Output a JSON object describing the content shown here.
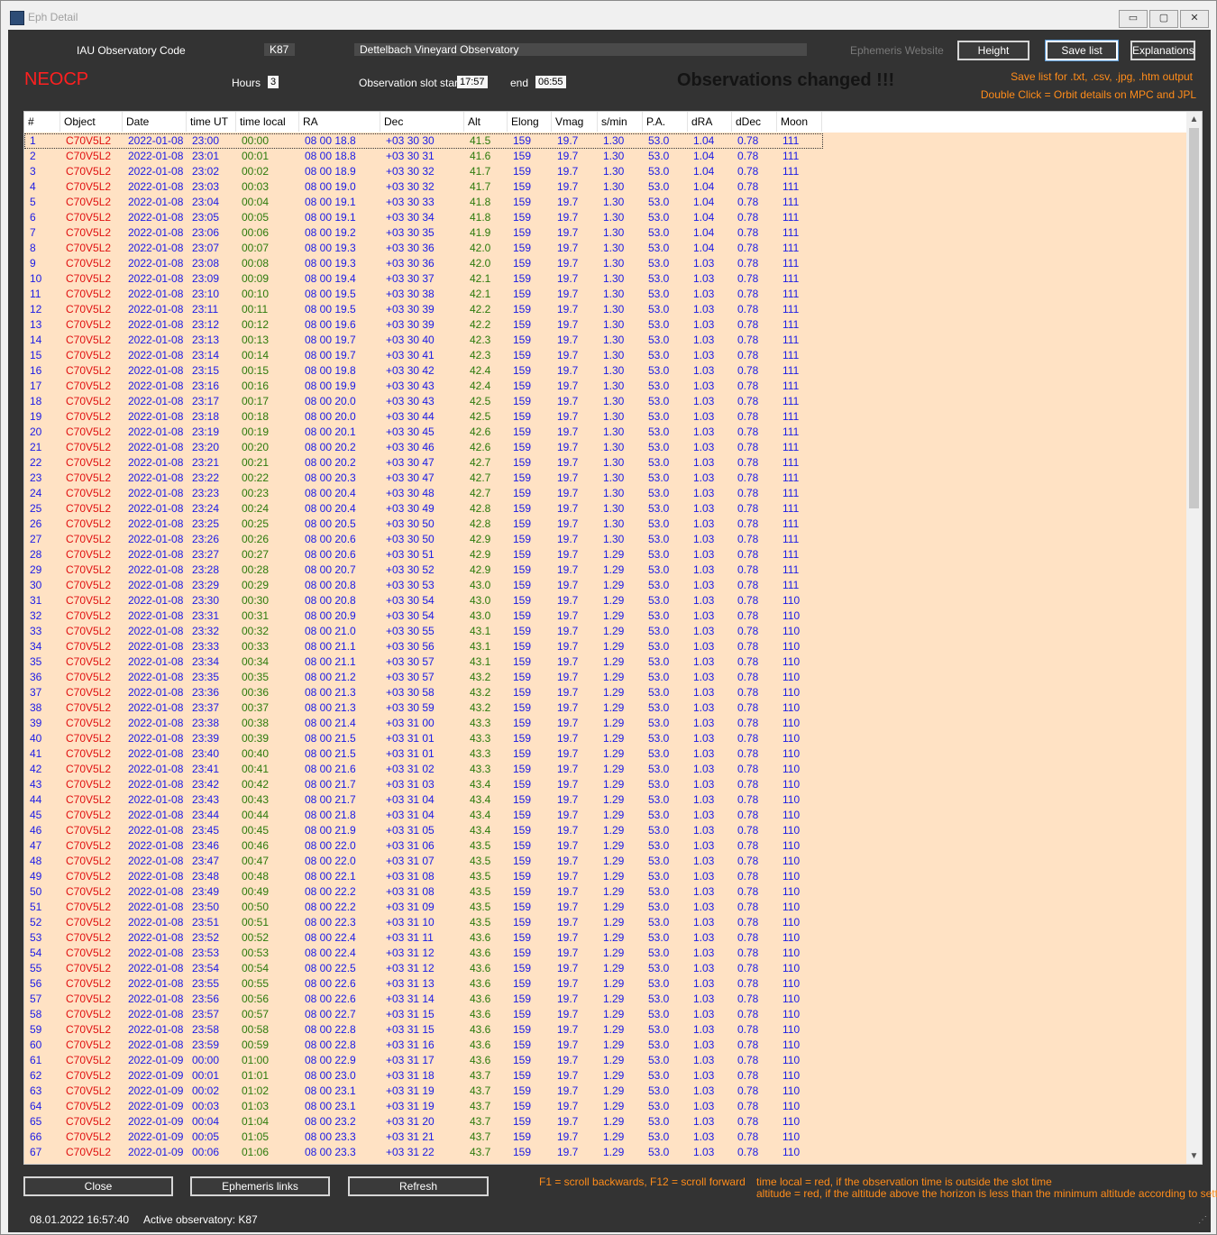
{
  "window": {
    "title": "Eph Detail",
    "min": "▭",
    "max": "▢",
    "close": "✕"
  },
  "header": {
    "iau_label": "IAU Observatory Code",
    "iau_code": "K87",
    "observatory_name": "Dettelbach Vineyard Observatory",
    "ephemeris_website": "Ephemeris Website",
    "height_button": "Height",
    "save_list_button": "Save list",
    "explanations_button": "Explanations",
    "neocp": "NEOCP",
    "hours_label": "Hours",
    "hours_value": "3",
    "slot_start_label": "Observation slot start",
    "slot_start_value": "17:57",
    "end_label": "end",
    "end_value": "06:55",
    "changed_notice": "Observations changed !!!",
    "save_hint": "Save list for .txt, .csv, .jpg, .htm output",
    "dblclick_hint": "Double Click = Orbit details on MPC and JPL"
  },
  "columns": [
    "#",
    "Object",
    "Date",
    "time UT",
    "time local",
    "RA",
    "Dec",
    "Alt",
    "Elong",
    "Vmag",
    "s/min",
    "P.A.",
    "dRA",
    "dDec",
    "Moon"
  ],
  "rows": [
    [
      "1",
      "C70V5L2",
      "2022-01-08",
      "23:00",
      "00:00",
      "08 00 18.8",
      "+03 30 30",
      "41.5",
      "159",
      "19.7",
      "1.30",
      "53.0",
      "1.04",
      "0.78",
      "111"
    ],
    [
      "2",
      "C70V5L2",
      "2022-01-08",
      "23:01",
      "00:01",
      "08 00 18.8",
      "+03 30 31",
      "41.6",
      "159",
      "19.7",
      "1.30",
      "53.0",
      "1.04",
      "0.78",
      "111"
    ],
    [
      "3",
      "C70V5L2",
      "2022-01-08",
      "23:02",
      "00:02",
      "08 00 18.9",
      "+03 30 32",
      "41.7",
      "159",
      "19.7",
      "1.30",
      "53.0",
      "1.04",
      "0.78",
      "111"
    ],
    [
      "4",
      "C70V5L2",
      "2022-01-08",
      "23:03",
      "00:03",
      "08 00 19.0",
      "+03 30 32",
      "41.7",
      "159",
      "19.7",
      "1.30",
      "53.0",
      "1.04",
      "0.78",
      "111"
    ],
    [
      "5",
      "C70V5L2",
      "2022-01-08",
      "23:04",
      "00:04",
      "08 00 19.1",
      "+03 30 33",
      "41.8",
      "159",
      "19.7",
      "1.30",
      "53.0",
      "1.04",
      "0.78",
      "111"
    ],
    [
      "6",
      "C70V5L2",
      "2022-01-08",
      "23:05",
      "00:05",
      "08 00 19.1",
      "+03 30 34",
      "41.8",
      "159",
      "19.7",
      "1.30",
      "53.0",
      "1.04",
      "0.78",
      "111"
    ],
    [
      "7",
      "C70V5L2",
      "2022-01-08",
      "23:06",
      "00:06",
      "08 00 19.2",
      "+03 30 35",
      "41.9",
      "159",
      "19.7",
      "1.30",
      "53.0",
      "1.04",
      "0.78",
      "111"
    ],
    [
      "8",
      "C70V5L2",
      "2022-01-08",
      "23:07",
      "00:07",
      "08 00 19.3",
      "+03 30 36",
      "42.0",
      "159",
      "19.7",
      "1.30",
      "53.0",
      "1.04",
      "0.78",
      "111"
    ],
    [
      "9",
      "C70V5L2",
      "2022-01-08",
      "23:08",
      "00:08",
      "08 00 19.3",
      "+03 30 36",
      "42.0",
      "159",
      "19.7",
      "1.30",
      "53.0",
      "1.03",
      "0.78",
      "111"
    ],
    [
      "10",
      "C70V5L2",
      "2022-01-08",
      "23:09",
      "00:09",
      "08 00 19.4",
      "+03 30 37",
      "42.1",
      "159",
      "19.7",
      "1.30",
      "53.0",
      "1.03",
      "0.78",
      "111"
    ],
    [
      "11",
      "C70V5L2",
      "2022-01-08",
      "23:10",
      "00:10",
      "08 00 19.5",
      "+03 30 38",
      "42.1",
      "159",
      "19.7",
      "1.30",
      "53.0",
      "1.03",
      "0.78",
      "111"
    ],
    [
      "12",
      "C70V5L2",
      "2022-01-08",
      "23:11",
      "00:11",
      "08 00 19.5",
      "+03 30 39",
      "42.2",
      "159",
      "19.7",
      "1.30",
      "53.0",
      "1.03",
      "0.78",
      "111"
    ],
    [
      "13",
      "C70V5L2",
      "2022-01-08",
      "23:12",
      "00:12",
      "08 00 19.6",
      "+03 30 39",
      "42.2",
      "159",
      "19.7",
      "1.30",
      "53.0",
      "1.03",
      "0.78",
      "111"
    ],
    [
      "14",
      "C70V5L2",
      "2022-01-08",
      "23:13",
      "00:13",
      "08 00 19.7",
      "+03 30 40",
      "42.3",
      "159",
      "19.7",
      "1.30",
      "53.0",
      "1.03",
      "0.78",
      "111"
    ],
    [
      "15",
      "C70V5L2",
      "2022-01-08",
      "23:14",
      "00:14",
      "08 00 19.7",
      "+03 30 41",
      "42.3",
      "159",
      "19.7",
      "1.30",
      "53.0",
      "1.03",
      "0.78",
      "111"
    ],
    [
      "16",
      "C70V5L2",
      "2022-01-08",
      "23:15",
      "00:15",
      "08 00 19.8",
      "+03 30 42",
      "42.4",
      "159",
      "19.7",
      "1.30",
      "53.0",
      "1.03",
      "0.78",
      "111"
    ],
    [
      "17",
      "C70V5L2",
      "2022-01-08",
      "23:16",
      "00:16",
      "08 00 19.9",
      "+03 30 43",
      "42.4",
      "159",
      "19.7",
      "1.30",
      "53.0",
      "1.03",
      "0.78",
      "111"
    ],
    [
      "18",
      "C70V5L2",
      "2022-01-08",
      "23:17",
      "00:17",
      "08 00 20.0",
      "+03 30 43",
      "42.5",
      "159",
      "19.7",
      "1.30",
      "53.0",
      "1.03",
      "0.78",
      "111"
    ],
    [
      "19",
      "C70V5L2",
      "2022-01-08",
      "23:18",
      "00:18",
      "08 00 20.0",
      "+03 30 44",
      "42.5",
      "159",
      "19.7",
      "1.30",
      "53.0",
      "1.03",
      "0.78",
      "111"
    ],
    [
      "20",
      "C70V5L2",
      "2022-01-08",
      "23:19",
      "00:19",
      "08 00 20.1",
      "+03 30 45",
      "42.6",
      "159",
      "19.7",
      "1.30",
      "53.0",
      "1.03",
      "0.78",
      "111"
    ],
    [
      "21",
      "C70V5L2",
      "2022-01-08",
      "23:20",
      "00:20",
      "08 00 20.2",
      "+03 30 46",
      "42.6",
      "159",
      "19.7",
      "1.30",
      "53.0",
      "1.03",
      "0.78",
      "111"
    ],
    [
      "22",
      "C70V5L2",
      "2022-01-08",
      "23:21",
      "00:21",
      "08 00 20.2",
      "+03 30 47",
      "42.7",
      "159",
      "19.7",
      "1.30",
      "53.0",
      "1.03",
      "0.78",
      "111"
    ],
    [
      "23",
      "C70V5L2",
      "2022-01-08",
      "23:22",
      "00:22",
      "08 00 20.3",
      "+03 30 47",
      "42.7",
      "159",
      "19.7",
      "1.30",
      "53.0",
      "1.03",
      "0.78",
      "111"
    ],
    [
      "24",
      "C70V5L2",
      "2022-01-08",
      "23:23",
      "00:23",
      "08 00 20.4",
      "+03 30 48",
      "42.7",
      "159",
      "19.7",
      "1.30",
      "53.0",
      "1.03",
      "0.78",
      "111"
    ],
    [
      "25",
      "C70V5L2",
      "2022-01-08",
      "23:24",
      "00:24",
      "08 00 20.4",
      "+03 30 49",
      "42.8",
      "159",
      "19.7",
      "1.30",
      "53.0",
      "1.03",
      "0.78",
      "111"
    ],
    [
      "26",
      "C70V5L2",
      "2022-01-08",
      "23:25",
      "00:25",
      "08 00 20.5",
      "+03 30 50",
      "42.8",
      "159",
      "19.7",
      "1.30",
      "53.0",
      "1.03",
      "0.78",
      "111"
    ],
    [
      "27",
      "C70V5L2",
      "2022-01-08",
      "23:26",
      "00:26",
      "08 00 20.6",
      "+03 30 50",
      "42.9",
      "159",
      "19.7",
      "1.30",
      "53.0",
      "1.03",
      "0.78",
      "111"
    ],
    [
      "28",
      "C70V5L2",
      "2022-01-08",
      "23:27",
      "00:27",
      "08 00 20.6",
      "+03 30 51",
      "42.9",
      "159",
      "19.7",
      "1.29",
      "53.0",
      "1.03",
      "0.78",
      "111"
    ],
    [
      "29",
      "C70V5L2",
      "2022-01-08",
      "23:28",
      "00:28",
      "08 00 20.7",
      "+03 30 52",
      "42.9",
      "159",
      "19.7",
      "1.29",
      "53.0",
      "1.03",
      "0.78",
      "111"
    ],
    [
      "30",
      "C70V5L2",
      "2022-01-08",
      "23:29",
      "00:29",
      "08 00 20.8",
      "+03 30 53",
      "43.0",
      "159",
      "19.7",
      "1.29",
      "53.0",
      "1.03",
      "0.78",
      "111"
    ],
    [
      "31",
      "C70V5L2",
      "2022-01-08",
      "23:30",
      "00:30",
      "08 00 20.8",
      "+03 30 54",
      "43.0",
      "159",
      "19.7",
      "1.29",
      "53.0",
      "1.03",
      "0.78",
      "110"
    ],
    [
      "32",
      "C70V5L2",
      "2022-01-08",
      "23:31",
      "00:31",
      "08 00 20.9",
      "+03 30 54",
      "43.0",
      "159",
      "19.7",
      "1.29",
      "53.0",
      "1.03",
      "0.78",
      "110"
    ],
    [
      "33",
      "C70V5L2",
      "2022-01-08",
      "23:32",
      "00:32",
      "08 00 21.0",
      "+03 30 55",
      "43.1",
      "159",
      "19.7",
      "1.29",
      "53.0",
      "1.03",
      "0.78",
      "110"
    ],
    [
      "34",
      "C70V5L2",
      "2022-01-08",
      "23:33",
      "00:33",
      "08 00 21.1",
      "+03 30 56",
      "43.1",
      "159",
      "19.7",
      "1.29",
      "53.0",
      "1.03",
      "0.78",
      "110"
    ],
    [
      "35",
      "C70V5L2",
      "2022-01-08",
      "23:34",
      "00:34",
      "08 00 21.1",
      "+03 30 57",
      "43.1",
      "159",
      "19.7",
      "1.29",
      "53.0",
      "1.03",
      "0.78",
      "110"
    ],
    [
      "36",
      "C70V5L2",
      "2022-01-08",
      "23:35",
      "00:35",
      "08 00 21.2",
      "+03 30 57",
      "43.2",
      "159",
      "19.7",
      "1.29",
      "53.0",
      "1.03",
      "0.78",
      "110"
    ],
    [
      "37",
      "C70V5L2",
      "2022-01-08",
      "23:36",
      "00:36",
      "08 00 21.3",
      "+03 30 58",
      "43.2",
      "159",
      "19.7",
      "1.29",
      "53.0",
      "1.03",
      "0.78",
      "110"
    ],
    [
      "38",
      "C70V5L2",
      "2022-01-08",
      "23:37",
      "00:37",
      "08 00 21.3",
      "+03 30 59",
      "43.2",
      "159",
      "19.7",
      "1.29",
      "53.0",
      "1.03",
      "0.78",
      "110"
    ],
    [
      "39",
      "C70V5L2",
      "2022-01-08",
      "23:38",
      "00:38",
      "08 00 21.4",
      "+03 31 00",
      "43.3",
      "159",
      "19.7",
      "1.29",
      "53.0",
      "1.03",
      "0.78",
      "110"
    ],
    [
      "40",
      "C70V5L2",
      "2022-01-08",
      "23:39",
      "00:39",
      "08 00 21.5",
      "+03 31 01",
      "43.3",
      "159",
      "19.7",
      "1.29",
      "53.0",
      "1.03",
      "0.78",
      "110"
    ],
    [
      "41",
      "C70V5L2",
      "2022-01-08",
      "23:40",
      "00:40",
      "08 00 21.5",
      "+03 31 01",
      "43.3",
      "159",
      "19.7",
      "1.29",
      "53.0",
      "1.03",
      "0.78",
      "110"
    ],
    [
      "42",
      "C70V5L2",
      "2022-01-08",
      "23:41",
      "00:41",
      "08 00 21.6",
      "+03 31 02",
      "43.3",
      "159",
      "19.7",
      "1.29",
      "53.0",
      "1.03",
      "0.78",
      "110"
    ],
    [
      "43",
      "C70V5L2",
      "2022-01-08",
      "23:42",
      "00:42",
      "08 00 21.7",
      "+03 31 03",
      "43.4",
      "159",
      "19.7",
      "1.29",
      "53.0",
      "1.03",
      "0.78",
      "110"
    ],
    [
      "44",
      "C70V5L2",
      "2022-01-08",
      "23:43",
      "00:43",
      "08 00 21.7",
      "+03 31 04",
      "43.4",
      "159",
      "19.7",
      "1.29",
      "53.0",
      "1.03",
      "0.78",
      "110"
    ],
    [
      "45",
      "C70V5L2",
      "2022-01-08",
      "23:44",
      "00:44",
      "08 00 21.8",
      "+03 31 04",
      "43.4",
      "159",
      "19.7",
      "1.29",
      "53.0",
      "1.03",
      "0.78",
      "110"
    ],
    [
      "46",
      "C70V5L2",
      "2022-01-08",
      "23:45",
      "00:45",
      "08 00 21.9",
      "+03 31 05",
      "43.4",
      "159",
      "19.7",
      "1.29",
      "53.0",
      "1.03",
      "0.78",
      "110"
    ],
    [
      "47",
      "C70V5L2",
      "2022-01-08",
      "23:46",
      "00:46",
      "08 00 22.0",
      "+03 31 06",
      "43.5",
      "159",
      "19.7",
      "1.29",
      "53.0",
      "1.03",
      "0.78",
      "110"
    ],
    [
      "48",
      "C70V5L2",
      "2022-01-08",
      "23:47",
      "00:47",
      "08 00 22.0",
      "+03 31 07",
      "43.5",
      "159",
      "19.7",
      "1.29",
      "53.0",
      "1.03",
      "0.78",
      "110"
    ],
    [
      "49",
      "C70V5L2",
      "2022-01-08",
      "23:48",
      "00:48",
      "08 00 22.1",
      "+03 31 08",
      "43.5",
      "159",
      "19.7",
      "1.29",
      "53.0",
      "1.03",
      "0.78",
      "110"
    ],
    [
      "50",
      "C70V5L2",
      "2022-01-08",
      "23:49",
      "00:49",
      "08 00 22.2",
      "+03 31 08",
      "43.5",
      "159",
      "19.7",
      "1.29",
      "53.0",
      "1.03",
      "0.78",
      "110"
    ],
    [
      "51",
      "C70V5L2",
      "2022-01-08",
      "23:50",
      "00:50",
      "08 00 22.2",
      "+03 31 09",
      "43.5",
      "159",
      "19.7",
      "1.29",
      "53.0",
      "1.03",
      "0.78",
      "110"
    ],
    [
      "52",
      "C70V5L2",
      "2022-01-08",
      "23:51",
      "00:51",
      "08 00 22.3",
      "+03 31 10",
      "43.5",
      "159",
      "19.7",
      "1.29",
      "53.0",
      "1.03",
      "0.78",
      "110"
    ],
    [
      "53",
      "C70V5L2",
      "2022-01-08",
      "23:52",
      "00:52",
      "08 00 22.4",
      "+03 31 11",
      "43.6",
      "159",
      "19.7",
      "1.29",
      "53.0",
      "1.03",
      "0.78",
      "110"
    ],
    [
      "54",
      "C70V5L2",
      "2022-01-08",
      "23:53",
      "00:53",
      "08 00 22.4",
      "+03 31 12",
      "43.6",
      "159",
      "19.7",
      "1.29",
      "53.0",
      "1.03",
      "0.78",
      "110"
    ],
    [
      "55",
      "C70V5L2",
      "2022-01-08",
      "23:54",
      "00:54",
      "08 00 22.5",
      "+03 31 12",
      "43.6",
      "159",
      "19.7",
      "1.29",
      "53.0",
      "1.03",
      "0.78",
      "110"
    ],
    [
      "56",
      "C70V5L2",
      "2022-01-08",
      "23:55",
      "00:55",
      "08 00 22.6",
      "+03 31 13",
      "43.6",
      "159",
      "19.7",
      "1.29",
      "53.0",
      "1.03",
      "0.78",
      "110"
    ],
    [
      "57",
      "C70V5L2",
      "2022-01-08",
      "23:56",
      "00:56",
      "08 00 22.6",
      "+03 31 14",
      "43.6",
      "159",
      "19.7",
      "1.29",
      "53.0",
      "1.03",
      "0.78",
      "110"
    ],
    [
      "58",
      "C70V5L2",
      "2022-01-08",
      "23:57",
      "00:57",
      "08 00 22.7",
      "+03 31 15",
      "43.6",
      "159",
      "19.7",
      "1.29",
      "53.0",
      "1.03",
      "0.78",
      "110"
    ],
    [
      "59",
      "C70V5L2",
      "2022-01-08",
      "23:58",
      "00:58",
      "08 00 22.8",
      "+03 31 15",
      "43.6",
      "159",
      "19.7",
      "1.29",
      "53.0",
      "1.03",
      "0.78",
      "110"
    ],
    [
      "60",
      "C70V5L2",
      "2022-01-08",
      "23:59",
      "00:59",
      "08 00 22.8",
      "+03 31 16",
      "43.6",
      "159",
      "19.7",
      "1.29",
      "53.0",
      "1.03",
      "0.78",
      "110"
    ],
    [
      "61",
      "C70V5L2",
      "2022-01-09",
      "00:00",
      "01:00",
      "08 00 22.9",
      "+03 31 17",
      "43.6",
      "159",
      "19.7",
      "1.29",
      "53.0",
      "1.03",
      "0.78",
      "110"
    ],
    [
      "62",
      "C70V5L2",
      "2022-01-09",
      "00:01",
      "01:01",
      "08 00 23.0",
      "+03 31 18",
      "43.7",
      "159",
      "19.7",
      "1.29",
      "53.0",
      "1.03",
      "0.78",
      "110"
    ],
    [
      "63",
      "C70V5L2",
      "2022-01-09",
      "00:02",
      "01:02",
      "08 00 23.1",
      "+03 31 19",
      "43.7",
      "159",
      "19.7",
      "1.29",
      "53.0",
      "1.03",
      "0.78",
      "110"
    ],
    [
      "64",
      "C70V5L2",
      "2022-01-09",
      "00:03",
      "01:03",
      "08 00 23.1",
      "+03 31 19",
      "43.7",
      "159",
      "19.7",
      "1.29",
      "53.0",
      "1.03",
      "0.78",
      "110"
    ],
    [
      "65",
      "C70V5L2",
      "2022-01-09",
      "00:04",
      "01:04",
      "08 00 23.2",
      "+03 31 20",
      "43.7",
      "159",
      "19.7",
      "1.29",
      "53.0",
      "1.03",
      "0.78",
      "110"
    ],
    [
      "66",
      "C70V5L2",
      "2022-01-09",
      "00:05",
      "01:05",
      "08 00 23.3",
      "+03 31 21",
      "43.7",
      "159",
      "19.7",
      "1.29",
      "53.0",
      "1.03",
      "0.78",
      "110"
    ],
    [
      "67",
      "C70V5L2",
      "2022-01-09",
      "00:06",
      "01:06",
      "08 00 23.3",
      "+03 31 22",
      "43.7",
      "159",
      "19.7",
      "1.29",
      "53.0",
      "1.03",
      "0.78",
      "110"
    ]
  ],
  "footer": {
    "close_button": "Close",
    "ephemeris_links_button": "Ephemeris links",
    "refresh_button": "Refresh",
    "scroll_hint": "F1 = scroll backwards, F12 = scroll forward",
    "time_local_hint": "time local = red, if the observation time is outside the slot time",
    "altitude_hint": "altitude = red, if the altitude above the horizon is less than the minimum altitude according to settings"
  },
  "statusbar": {
    "datetime": "08.01.2022 16:57:40",
    "active_observatory": "Active observatory: K87"
  },
  "colors": {
    "background": "#333333",
    "grid_background": "#ffe2c4",
    "object_text": "#e01010",
    "value_text": "#1a1ae6",
    "local_time_alt_text": "#2b7a0b",
    "hint_text": "#ff8c1a",
    "neocp": "#ff2020"
  },
  "icons": {
    "scroll_up": "chevron-up-icon",
    "scroll_down": "chevron-down-icon",
    "resize_grip": "resize-grip-icon"
  }
}
